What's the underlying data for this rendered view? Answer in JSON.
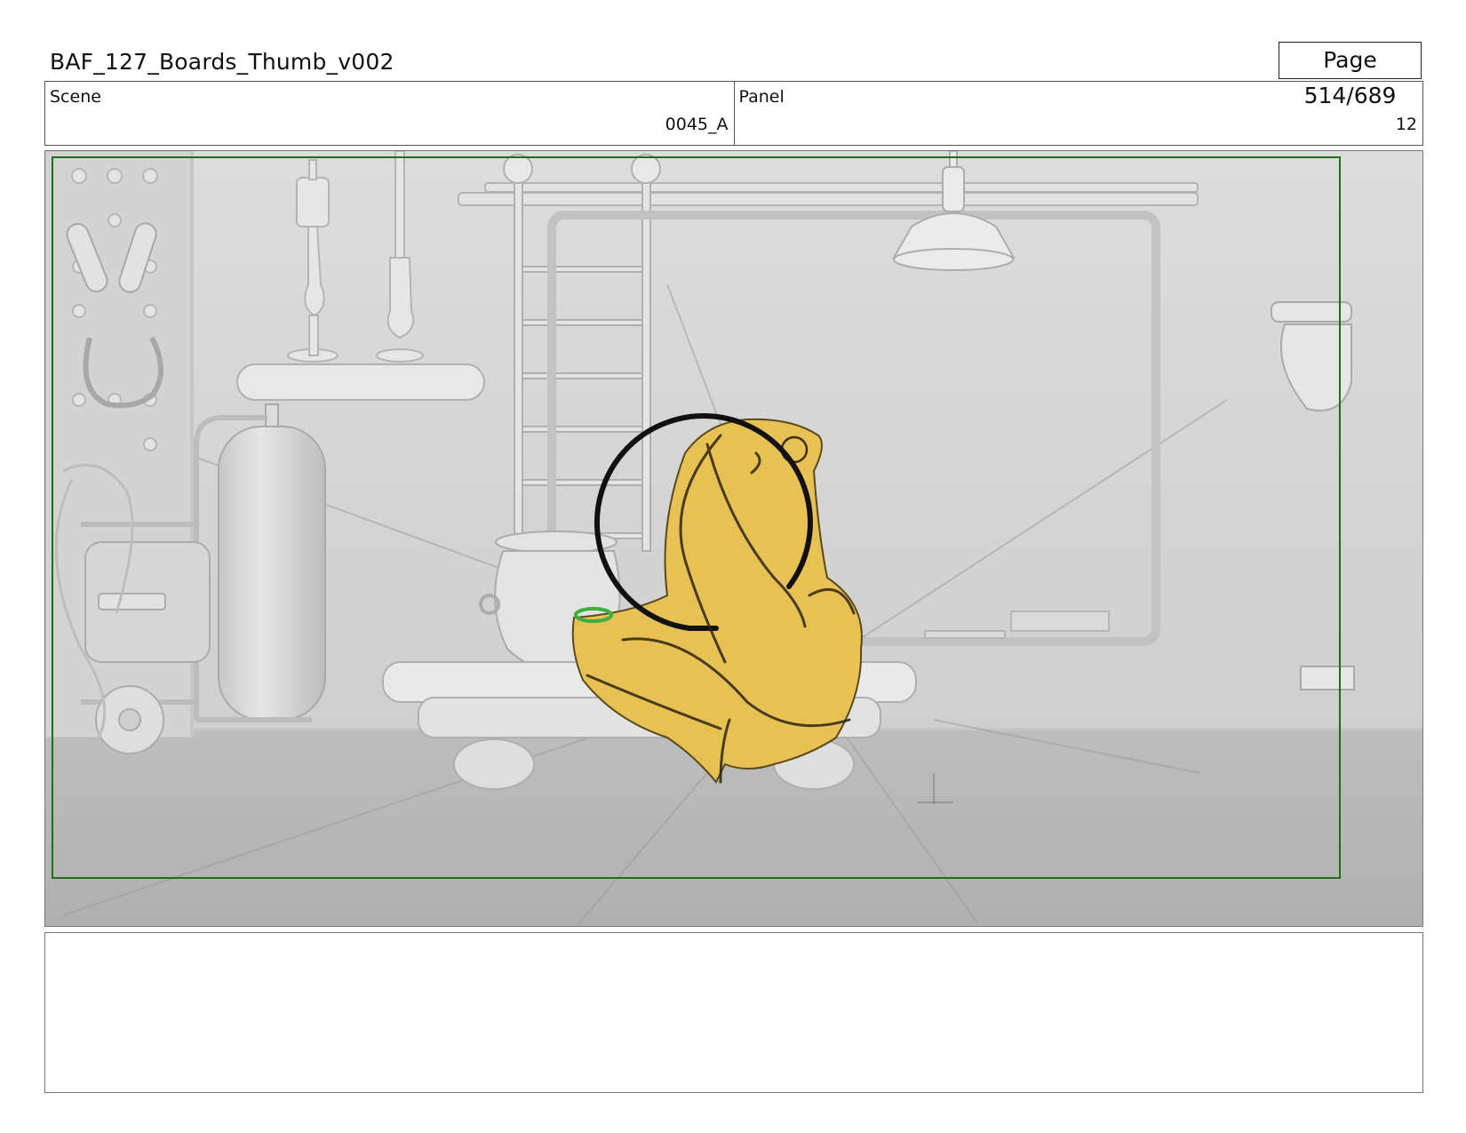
{
  "document": {
    "title": "BAF_127_Boards_Thumb_v002",
    "page_label": "Page 514/689"
  },
  "scene": {
    "label": "Scene",
    "value": "0045_A"
  },
  "panel": {
    "label": "Panel",
    "value": "12"
  },
  "frame": {
    "safe_frame_color": "#1e6e1e",
    "background_tone": "#d6d6d6",
    "character_fill": "#e8c155",
    "character_outline": "#111111"
  },
  "notes": {
    "text": ""
  }
}
